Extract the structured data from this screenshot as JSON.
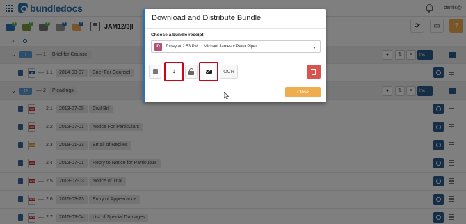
{
  "header": {
    "logo_text": "bundledocs",
    "username": "demis@",
    "icons": [
      "apps-grid-icon",
      "bell-icon"
    ]
  },
  "toolbar": {
    "bundle_name": "JAM12/3|I",
    "buttons": [
      {
        "name": "new-bundle-button",
        "icon": "briefcase-plus-icon",
        "color": "#2a72b5",
        "badge_color": "#5cb85c"
      },
      {
        "name": "new-section-button",
        "icon": "folder-plus-icon",
        "color": "#7a9a3a",
        "badge_color": "#5cb85c"
      },
      {
        "name": "add-documents-button",
        "icon": "stack-plus-icon",
        "color": "#777777",
        "badge_color": "#5cb85c"
      },
      {
        "name": "add-file-button",
        "icon": "file-plus-icon",
        "color": "#999999",
        "badge_color": "#2a72b5"
      },
      {
        "name": "add-note-button",
        "icon": "note-plus-icon",
        "color": "#f0ad4e",
        "badge_color": "#2a72b5"
      }
    ],
    "right_icons": [
      "refresh-icon",
      "monitor-icon",
      "help-icon"
    ]
  },
  "tree": {
    "rows": [
      {
        "type": "section",
        "badge": "1",
        "index": "1",
        "title": "Brief for Counsel",
        "inc": "Inc"
      },
      {
        "type": "doc",
        "file": "W",
        "file_color": "#2b579a",
        "index": "1.1",
        "date": "2014-03-07",
        "title": "Brief For Counsel"
      },
      {
        "type": "section",
        "badge": "14",
        "index": "2",
        "title": "Pleadings",
        "inc": "Inc"
      },
      {
        "type": "doc",
        "file": "PDF",
        "file_color": "#c9302c",
        "index": "2.1",
        "date": "2013-07-05",
        "title": "Civil Bill"
      },
      {
        "type": "doc",
        "file": "PDF",
        "file_color": "#c9302c",
        "index": "2.2",
        "date": "2013-07-01",
        "title": "Notice For Particulars"
      },
      {
        "type": "doc",
        "file": "MSG",
        "file_color": "#e0a030",
        "index": "2.3",
        "date": "2018-01-23",
        "title": "Email of Replies"
      },
      {
        "type": "doc",
        "file": "PDF",
        "file_color": "#c9302c",
        "index": "2.4",
        "date": "2013-07-01",
        "title": "Reply to Notice for Particulars"
      },
      {
        "type": "doc",
        "file": "PDF",
        "file_color": "#c9302c",
        "index": "2.5",
        "date": "2013-07-03",
        "title": "Notice of Trial"
      },
      {
        "type": "doc",
        "file": "PDF",
        "file_color": "#c9302c",
        "index": "2.6",
        "date": "2015-03-23",
        "title": "Entry of Appearance"
      },
      {
        "type": "doc",
        "file": "PDF",
        "file_color": "#c9302c",
        "index": "2.7",
        "date": "2015-03-04",
        "title": "List of Special Damages"
      }
    ]
  },
  "modal": {
    "title": "Download and Distribute Bundle",
    "receipt_label": "Choose a bundle receipt",
    "receipt_avatar": "D",
    "receipt_text": "Today at 2:53 PM ... Michael James v Peter Piper",
    "ocr_label": "OCR",
    "close_label": "Close"
  },
  "colors": {
    "brand": "#2a72b5",
    "highlight": "#d0021b",
    "close_button": "#f0ad4e",
    "delete_button": "#d9534f"
  }
}
